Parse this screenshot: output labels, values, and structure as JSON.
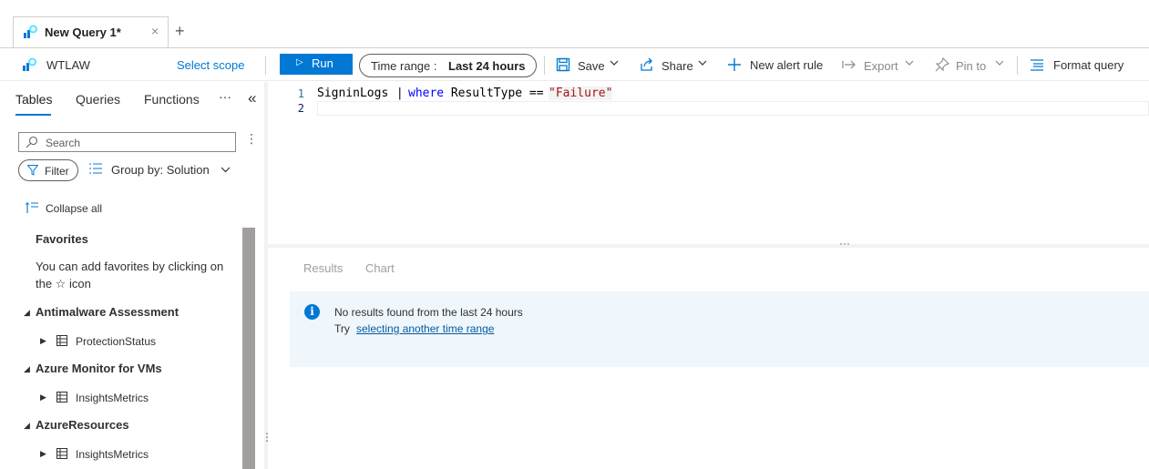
{
  "tabs": {
    "active_label": "New Query 1*",
    "close_glyph": "×",
    "add_glyph": "+"
  },
  "toolbar": {
    "workspace_name": "WTLAW",
    "select_scope": "Select scope",
    "run_label": "Run",
    "time_range_prefix": "Time range :",
    "time_range_value": "Last 24 hours",
    "save_label": "Save",
    "share_label": "Share",
    "new_alert_label": "New alert rule",
    "export_label": "Export",
    "pin_label": "Pin to",
    "format_label": "Format query"
  },
  "left_panel": {
    "tabs": [
      "Tables",
      "Queries",
      "Functions"
    ],
    "more_glyph": "···",
    "collapse_glyph": "«",
    "search_placeholder": "Search",
    "filter_label": "Filter",
    "group_by_label": "Group by: Solution",
    "collapse_all_label": "Collapse all",
    "favorites_title": "Favorites",
    "favorites_hint_line1": "You can add favorites by clicking on",
    "favorites_hint_line2": "the ☆ icon",
    "groups": [
      {
        "name": "Antimalware Assessment",
        "table": "ProtectionStatus"
      },
      {
        "name": "Azure Monitor for VMs",
        "table": "InsightsMetrics"
      },
      {
        "name": "AzureResources",
        "table": "InsightsMetrics"
      }
    ]
  },
  "editor": {
    "line_numbers": [
      "1",
      "2"
    ],
    "token_table": "SigninLogs",
    "token_pipe": " | ",
    "token_keyword": "where",
    "token_field": " ResultType == ",
    "token_string": "\"Failure\""
  },
  "results": {
    "tabs": [
      "Results",
      "Chart"
    ],
    "message": "No results found from the last 24 hours",
    "try_label": "Try",
    "link_label": "selecting another time range",
    "splitter_glyph": "···"
  },
  "colors": {
    "accent": "#0078d4",
    "info_bg": "#eff6fc",
    "keyword": "#0000ff",
    "string": "#a31515"
  }
}
